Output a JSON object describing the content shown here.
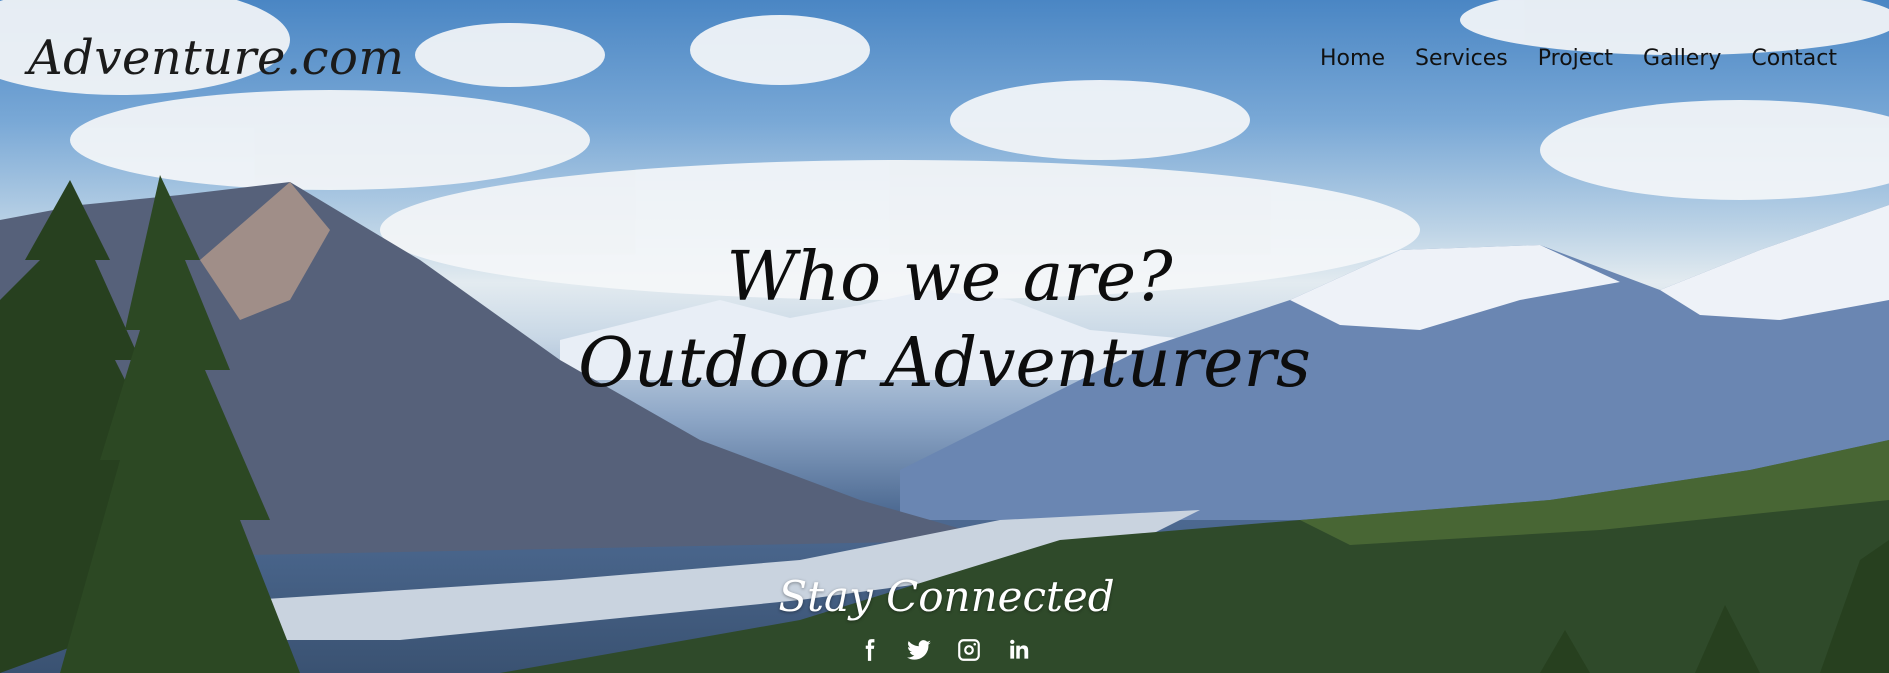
{
  "header": {
    "logo": "Adventure.com",
    "nav": [
      "Home",
      "Services",
      "Project",
      "Gallery",
      "Contact"
    ]
  },
  "hero": {
    "title_line1": "Who we are?",
    "title_line2": "Outdoor Adventurers"
  },
  "footer": {
    "stay_connected": "Stay Connected",
    "social_icons": [
      "facebook-icon",
      "twitter-icon",
      "instagram-icon",
      "linkedin-icon"
    ]
  },
  "colors": {
    "logo_text": "#1b1b1b",
    "nav_text": "#111111",
    "headline_text": "#0d0d0d",
    "connect_text": "#ffffff"
  }
}
